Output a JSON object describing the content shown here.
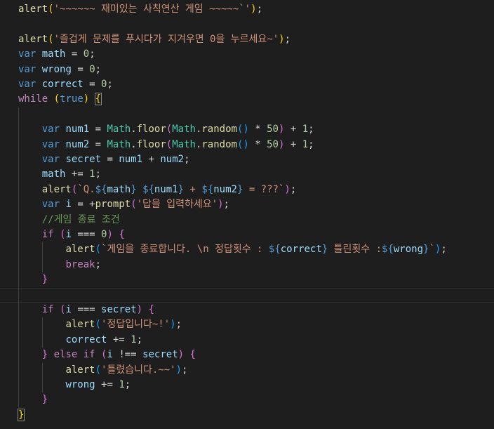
{
  "editor": {
    "language": "javascript",
    "colors": {
      "background": "#1e1e1e",
      "function": "#dcdcaa",
      "string": "#ce9178",
      "keyword": "#569cd6",
      "control": "#c586c0",
      "variable": "#9cdcfe",
      "number": "#b5cea8",
      "class": "#4ec9b0",
      "comment": "#6a9955",
      "bracket1": "#ffd700",
      "bracket2": "#da70d6",
      "bracket3": "#179fff"
    },
    "lines": [
      [
        [
          "fn",
          "alert"
        ],
        [
          "p1",
          "("
        ],
        [
          "str",
          "'~~~~~~ 재미있는 사칙연산 게임 ~~~~~`'"
        ],
        [
          "p1",
          ")"
        ],
        [
          "pl",
          ";"
        ]
      ],
      [],
      [
        [
          "fn",
          "alert"
        ],
        [
          "p1",
          "("
        ],
        [
          "str",
          "'즐겁게 문제를 푸시다가 지겨우면 0을 누르세요~'"
        ],
        [
          "p1",
          ")"
        ],
        [
          "pl",
          ";"
        ]
      ],
      [
        [
          "kw",
          "var"
        ],
        [
          "pl",
          " "
        ],
        [
          "var",
          "math"
        ],
        [
          "pl",
          " = "
        ],
        [
          "num",
          "0"
        ],
        [
          "pl",
          ";"
        ]
      ],
      [
        [
          "kw",
          "var"
        ],
        [
          "pl",
          " "
        ],
        [
          "var",
          "wrong"
        ],
        [
          "pl",
          " = "
        ],
        [
          "num",
          "0"
        ],
        [
          "pl",
          ";"
        ]
      ],
      [
        [
          "kw",
          "var"
        ],
        [
          "pl",
          " "
        ],
        [
          "var",
          "correct"
        ],
        [
          "pl",
          " = "
        ],
        [
          "num",
          "0"
        ],
        [
          "pl",
          ";"
        ]
      ],
      [
        [
          "ctrl",
          "while"
        ],
        [
          "pl",
          " "
        ],
        [
          "p1",
          "("
        ],
        [
          "kw",
          "true"
        ],
        [
          "p1",
          ")"
        ],
        [
          "pl",
          " "
        ],
        [
          "p1",
          "{"
        ]
      ],
      [],
      [
        [
          "pl",
          "    "
        ],
        [
          "kw",
          "var"
        ],
        [
          "pl",
          " "
        ],
        [
          "var",
          "num1"
        ],
        [
          "pl",
          " = "
        ],
        [
          "cls",
          "Math"
        ],
        [
          "pl",
          "."
        ],
        [
          "fn",
          "floor"
        ],
        [
          "p2",
          "("
        ],
        [
          "cls",
          "Math"
        ],
        [
          "pl",
          "."
        ],
        [
          "fn",
          "random"
        ],
        [
          "p3",
          "()"
        ],
        [
          "pl",
          " * "
        ],
        [
          "num",
          "50"
        ],
        [
          "p2",
          ")"
        ],
        [
          "pl",
          " + "
        ],
        [
          "num",
          "1"
        ],
        [
          "pl",
          ";"
        ]
      ],
      [
        [
          "pl",
          "    "
        ],
        [
          "kw",
          "var"
        ],
        [
          "pl",
          " "
        ],
        [
          "var",
          "num2"
        ],
        [
          "pl",
          " = "
        ],
        [
          "cls",
          "Math"
        ],
        [
          "pl",
          "."
        ],
        [
          "fn",
          "floor"
        ],
        [
          "p2",
          "("
        ],
        [
          "cls",
          "Math"
        ],
        [
          "pl",
          "."
        ],
        [
          "fn",
          "random"
        ],
        [
          "p3",
          "()"
        ],
        [
          "pl",
          " * "
        ],
        [
          "num",
          "50"
        ],
        [
          "p2",
          ")"
        ],
        [
          "pl",
          " + "
        ],
        [
          "num",
          "1"
        ],
        [
          "pl",
          ";"
        ]
      ],
      [
        [
          "pl",
          "    "
        ],
        [
          "kw",
          "var"
        ],
        [
          "pl",
          " "
        ],
        [
          "var",
          "secret"
        ],
        [
          "pl",
          " = "
        ],
        [
          "var",
          "num1"
        ],
        [
          "pl",
          " + "
        ],
        [
          "var",
          "num2"
        ],
        [
          "pl",
          ";"
        ]
      ],
      [
        [
          "pl",
          "    "
        ],
        [
          "var",
          "math"
        ],
        [
          "pl",
          " += "
        ],
        [
          "num",
          "1"
        ],
        [
          "pl",
          ";"
        ]
      ],
      [
        [
          "pl",
          "    "
        ],
        [
          "fn",
          "alert"
        ],
        [
          "p2",
          "("
        ],
        [
          "str",
          "`Q."
        ],
        [
          "kw",
          "${"
        ],
        [
          "var",
          "math"
        ],
        [
          "kw",
          "}"
        ],
        [
          "str",
          " "
        ],
        [
          "kw",
          "${"
        ],
        [
          "var",
          "num1"
        ],
        [
          "kw",
          "}"
        ],
        [
          "str",
          " + "
        ],
        [
          "kw",
          "${"
        ],
        [
          "var",
          "num2"
        ],
        [
          "kw",
          "}"
        ],
        [
          "str",
          " = ???`"
        ],
        [
          "p2",
          ")"
        ],
        [
          "pl",
          ";"
        ]
      ],
      [
        [
          "pl",
          "    "
        ],
        [
          "kw",
          "var"
        ],
        [
          "pl",
          " "
        ],
        [
          "var",
          "i"
        ],
        [
          "pl",
          " = +"
        ],
        [
          "fn",
          "prompt"
        ],
        [
          "p2",
          "("
        ],
        [
          "str",
          "'답을 입력하세요'"
        ],
        [
          "p2",
          ")"
        ],
        [
          "pl",
          ";"
        ]
      ],
      [
        [
          "pl",
          "    "
        ],
        [
          "cm",
          "//게임 종료 조건"
        ]
      ],
      [
        [
          "pl",
          "    "
        ],
        [
          "ctrl",
          "if"
        ],
        [
          "pl",
          " "
        ],
        [
          "p2",
          "("
        ],
        [
          "var",
          "i"
        ],
        [
          "pl",
          " === "
        ],
        [
          "num",
          "0"
        ],
        [
          "p2",
          ")"
        ],
        [
          "pl",
          " "
        ],
        [
          "p2",
          "{"
        ]
      ],
      [
        [
          "pl",
          "        "
        ],
        [
          "fn",
          "alert"
        ],
        [
          "p3",
          "("
        ],
        [
          "str",
          "`게임을 종료합니다. \\n 정답횟수 : "
        ],
        [
          "kw",
          "${"
        ],
        [
          "var",
          "correct"
        ],
        [
          "kw",
          "}"
        ],
        [
          "str",
          " 틀린횟수 :"
        ],
        [
          "kw",
          "${"
        ],
        [
          "var",
          "wrong"
        ],
        [
          "kw",
          "}"
        ],
        [
          "str",
          "`"
        ],
        [
          "p3",
          ")"
        ],
        [
          "pl",
          ";"
        ]
      ],
      [
        [
          "pl",
          "        "
        ],
        [
          "ctrl",
          "break"
        ],
        [
          "pl",
          ";"
        ]
      ],
      [
        [
          "pl",
          "    "
        ],
        [
          "p2",
          "}"
        ]
      ],
      [],
      [
        [
          "pl",
          "    "
        ],
        [
          "ctrl",
          "if"
        ],
        [
          "pl",
          " "
        ],
        [
          "p2",
          "("
        ],
        [
          "var",
          "i"
        ],
        [
          "pl",
          " === "
        ],
        [
          "var",
          "secret"
        ],
        [
          "p2",
          ")"
        ],
        [
          "pl",
          " "
        ],
        [
          "p2",
          "{"
        ]
      ],
      [
        [
          "pl",
          "        "
        ],
        [
          "fn",
          "alert"
        ],
        [
          "p3",
          "("
        ],
        [
          "str",
          "'정답입니다~!'"
        ],
        [
          "p3",
          ")"
        ],
        [
          "pl",
          ";"
        ]
      ],
      [
        [
          "pl",
          "        "
        ],
        [
          "var",
          "correct"
        ],
        [
          "pl",
          " += "
        ],
        [
          "num",
          "1"
        ],
        [
          "pl",
          ";"
        ]
      ],
      [
        [
          "pl",
          "    "
        ],
        [
          "p2",
          "}"
        ],
        [
          "pl",
          " "
        ],
        [
          "ctrl",
          "else"
        ],
        [
          "pl",
          " "
        ],
        [
          "ctrl",
          "if"
        ],
        [
          "pl",
          " "
        ],
        [
          "p2",
          "("
        ],
        [
          "var",
          "i"
        ],
        [
          "pl",
          " !== "
        ],
        [
          "var",
          "secret"
        ],
        [
          "p2",
          ")"
        ],
        [
          "pl",
          " "
        ],
        [
          "p2",
          "{"
        ]
      ],
      [
        [
          "pl",
          "        "
        ],
        [
          "fn",
          "alert"
        ],
        [
          "p3",
          "("
        ],
        [
          "str",
          "'틀렸습니다.~~'"
        ],
        [
          "p3",
          ")"
        ],
        [
          "pl",
          ";"
        ]
      ],
      [
        [
          "pl",
          "        "
        ],
        [
          "var",
          "wrong"
        ],
        [
          "pl",
          " += "
        ],
        [
          "num",
          "1"
        ],
        [
          "pl",
          ";"
        ]
      ],
      [
        [
          "pl",
          "    "
        ],
        [
          "p2",
          "}"
        ]
      ],
      [
        [
          "p1",
          "}"
        ]
      ]
    ]
  }
}
